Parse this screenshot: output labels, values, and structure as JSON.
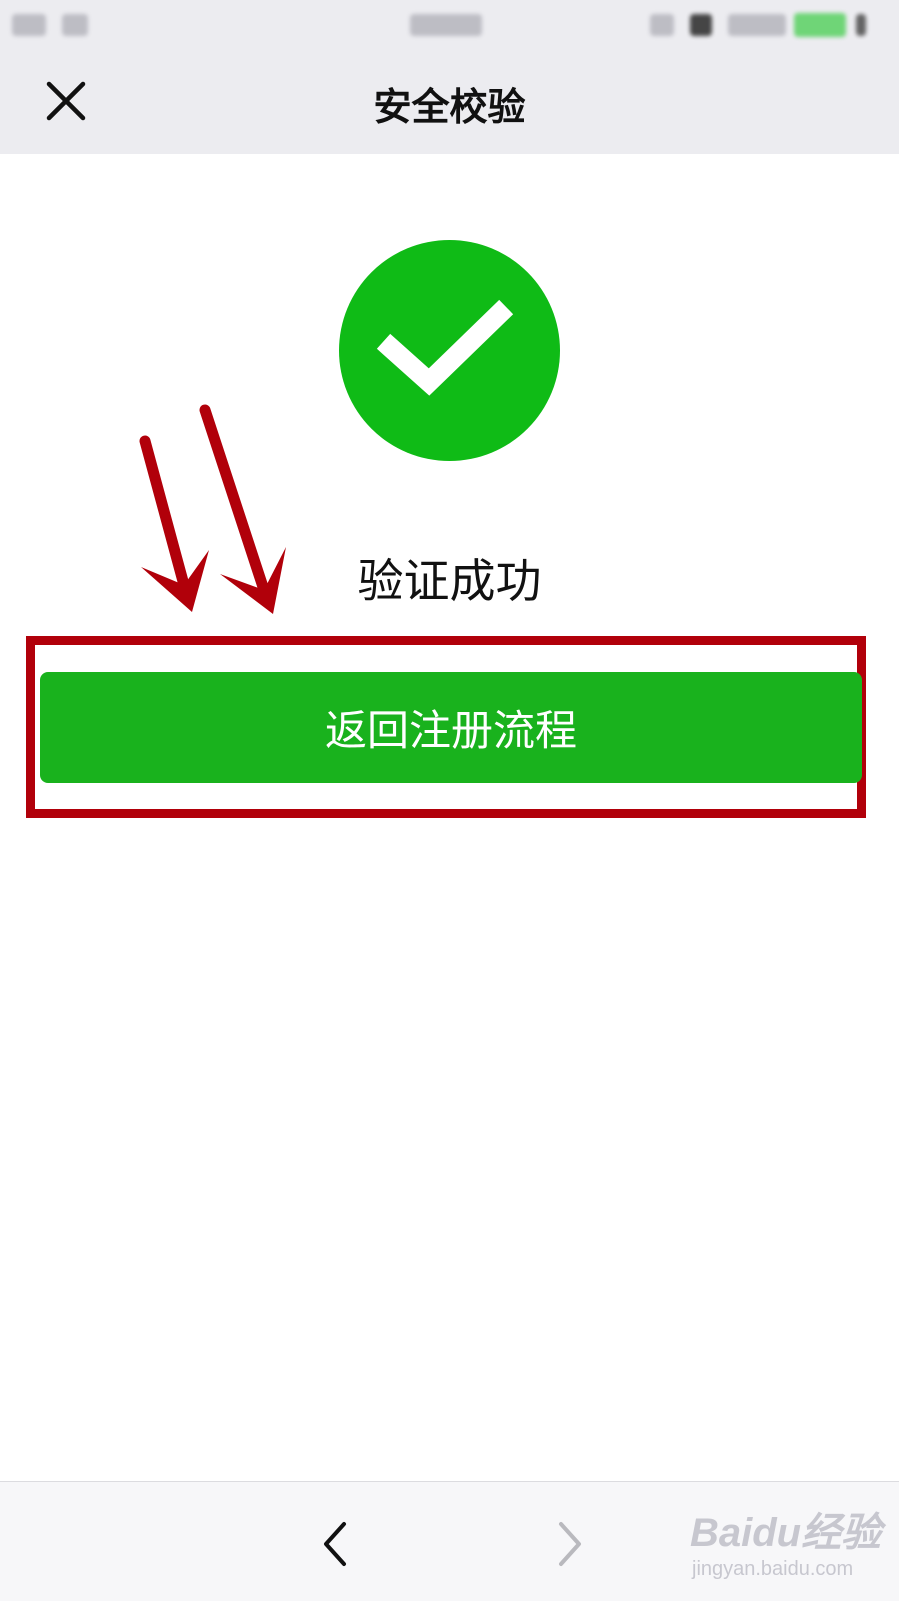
{
  "statusbar": {},
  "navbar": {
    "title": "安全校验",
    "close_icon": "close-icon"
  },
  "main": {
    "success_icon": "checkmark-circle-icon",
    "success_color": "#0fbb16",
    "message": "验证成功",
    "button_label": "返回注册流程",
    "button_color": "#19b21d",
    "annotation_color": "#b1000a"
  },
  "toolbar": {
    "back_icon": "chevron-left-icon",
    "forward_icon": "chevron-right-icon"
  },
  "watermark": {
    "logo": "Baidu经验",
    "url": "jingyan.baidu.com"
  }
}
